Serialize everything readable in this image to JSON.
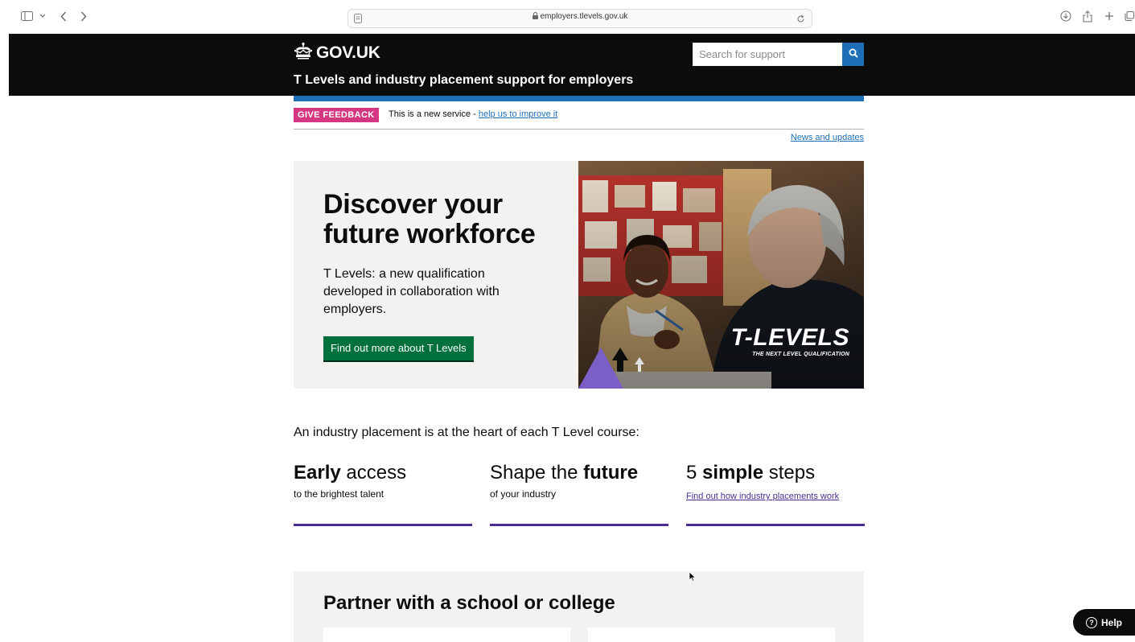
{
  "browser": {
    "url": "employers.tlevels.gov.uk",
    "icons": [
      "sidebar-icon",
      "chevron-down-icon",
      "back-icon",
      "forward-icon",
      "reader-icon",
      "lock-icon",
      "reload-icon",
      "download-icon",
      "share-icon",
      "new-tab-icon",
      "tabs-overview-icon"
    ]
  },
  "header": {
    "logo_text": "GOV.UK",
    "service_name": "T Levels and industry placement support for employers",
    "search_placeholder": "Search for support",
    "search_value": ""
  },
  "phase_banner": {
    "tag": "GIVE FEEDBACK",
    "text": "This is a new service - ",
    "link": "help us to improve it"
  },
  "news_link": "News and updates",
  "hero": {
    "title": "Discover your future workforce",
    "body": "T Levels: a new qualification developed in collaboration with employers.",
    "button": "Find out more about T Levels",
    "image_logo": "T-LEVELS",
    "image_tagline": "THE NEXT LEVEL QUALIFICATION"
  },
  "intro": "An industry placement is at the heart of each T Level course:",
  "features": [
    {
      "title_bold": "Early",
      "title_rest": " access",
      "subtitle": "to the brightest talent"
    },
    {
      "title_pre": "Shape the ",
      "title_bold": "future",
      "subtitle": "of your industry"
    },
    {
      "title_pre": "5 ",
      "title_bold": "simple",
      "title_rest": " steps",
      "link": "Find out how industry placements work"
    }
  ],
  "partner": {
    "title": "Partner with a school or college"
  },
  "help_button": "Help",
  "colors": {
    "header_bg": "#0b0c0c",
    "brand_blue": "#1d70b8",
    "feedback_pink": "#d53880",
    "button_green": "#00703c",
    "feature_purple": "#4c2c92",
    "panel_grey": "#f3f2f1"
  }
}
